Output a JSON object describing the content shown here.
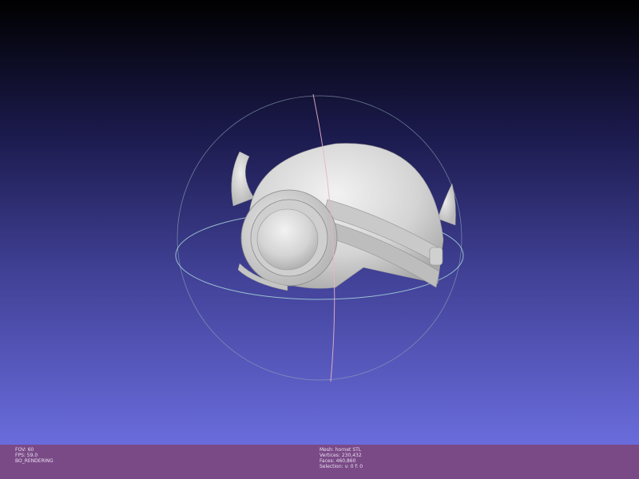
{
  "window": {
    "title": ""
  },
  "viewport": {
    "background_top": "#000000",
    "background_bottom": "#6a6cdc",
    "model_color": "#d6d6d6",
    "trackball_ring_color": "#9fc4c8",
    "trackball_axis_color": "#e8b3c6"
  },
  "status": {
    "left": [
      "FOV: 60",
      "FPS:  59.0",
      "BO_RENDERING"
    ],
    "right": [
      "Mesh: hornet STL",
      "Vertices: 230,432",
      "Faces: 460,860",
      "Selection: v: 0 f: 0"
    ],
    "bar_color": "#7a4a86"
  }
}
